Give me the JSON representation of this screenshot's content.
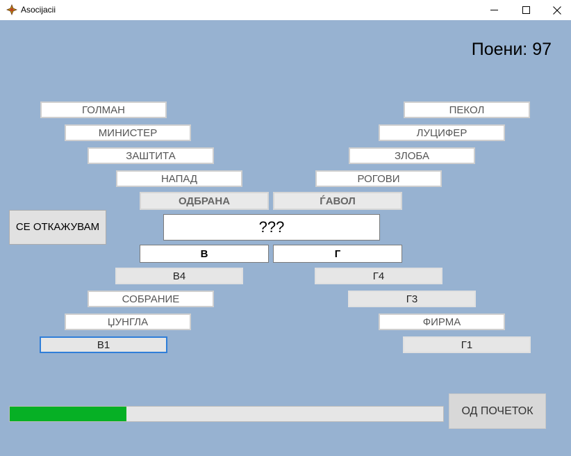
{
  "window": {
    "title": "Asocijacii"
  },
  "score": {
    "text": "Поени: 97"
  },
  "columns": {
    "a": {
      "items": [
        "ГОЛМАН",
        "МИНИСТЕР",
        "ЗАШТИТА",
        "НАПАД"
      ],
      "answer": "ОДБРАНА"
    },
    "b": {
      "items": [
        "ПЕКОЛ",
        "ЛУЦИФЕР",
        "ЗЛОБА",
        "РОГОВИ"
      ],
      "answer": "ЃАВОЛ"
    },
    "c": {
      "answer": "В",
      "items": [
        "В4",
        "СОБРАНИЕ",
        "ЏУНГЛА",
        "В1"
      ]
    },
    "d": {
      "answer": "Г",
      "items": [
        "Г4",
        "Г3",
        "ФИРМА",
        "Г1"
      ]
    }
  },
  "final": {
    "text": "???"
  },
  "buttons": {
    "give_up": "СЕ ОТКАЖУВАМ",
    "restart": "ОД ПОЧЕТОК"
  },
  "progress": {
    "fraction": 0.27,
    "color": "#06b025"
  }
}
